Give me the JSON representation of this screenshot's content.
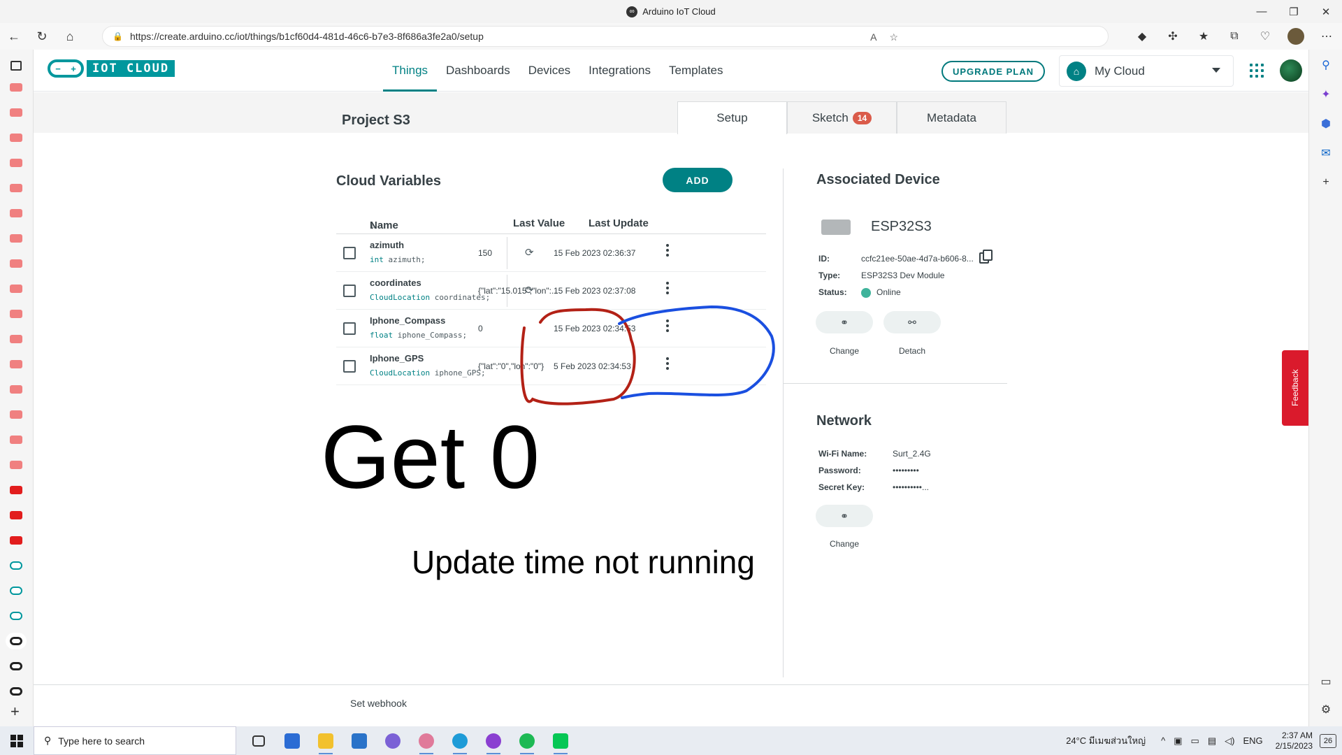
{
  "window": {
    "title": "Arduino IoT Cloud"
  },
  "browser": {
    "url": "https://create.arduino.cc/iot/things/b1cf60d4-481d-46c6-b7e3-8f686a3fe2a0/setup"
  },
  "app": {
    "nav": [
      {
        "label": "Things",
        "active": true
      },
      {
        "label": "Dashboards"
      },
      {
        "label": "Devices"
      },
      {
        "label": "Integrations"
      },
      {
        "label": "Templates"
      }
    ],
    "upgrade_label": "UPGRADE PLAN",
    "cloud_name": "My Cloud"
  },
  "thing": {
    "title": "Project S3",
    "tabs": [
      {
        "label": "Setup",
        "active": true
      },
      {
        "label": "Sketch",
        "badge": "14"
      },
      {
        "label": "Metadata"
      }
    ]
  },
  "variables": {
    "title": "Cloud Variables",
    "add_label": "ADD",
    "columns": {
      "name": "Name",
      "last_value": "Last Value",
      "last_update": "Last Update"
    },
    "rows": [
      {
        "name": "azimuth",
        "type": "int",
        "decl": " azimuth;",
        "value": "150",
        "updated": "15 Feb 2023 02:36:37",
        "sync": true
      },
      {
        "name": "coordinates",
        "type": "CloudLocation",
        "decl": " coordinates;",
        "value": "{\"lat\":\"15.015\",\"lon\":...",
        "updated": "15 Feb 2023 02:37:08",
        "sync": true
      },
      {
        "name": "Iphone_Compass",
        "type": "float",
        "decl": " iphone_Compass;",
        "value": "0",
        "updated": "15 Feb 2023 02:34:53",
        "sync": false
      },
      {
        "name": "Iphone_GPS",
        "type": "CloudLocation",
        "decl": " iphone_GPS;",
        "value": "{\"lat\":\"0\",\"lon\":\"0\"}",
        "updated": "5 Feb 2023 02:34:53",
        "sync": false
      }
    ]
  },
  "annotations": {
    "big": "Get 0",
    "sub": "Update time not running",
    "circle_colors": {
      "red": "#b32116",
      "blue": "#1a4fe0"
    }
  },
  "device": {
    "title": "Associated Device",
    "name": "ESP32S3",
    "id_label": "ID:",
    "id_value": "ccfc21ee-50ae-4d7a-b606-8...",
    "type_label": "Type:",
    "type_value": "ESP32S3 Dev Module",
    "status_label": "Status:",
    "status_value": "Online",
    "change_label": "Change",
    "detach_label": "Detach"
  },
  "network": {
    "title": "Network",
    "wifi_label": "Wi-Fi Name:",
    "wifi_value": "Surt_2.4G",
    "password_label": "Password:",
    "password_value": "•••••••••",
    "secret_label": "Secret Key:",
    "secret_value": "••••••••••...",
    "change_label": "Change"
  },
  "footer": {
    "webhook": "Set webhook"
  },
  "feedback": "Feedback",
  "taskbar": {
    "search_placeholder": "Type here to search",
    "weather": "24°C มีเมฆส่วนใหญ่",
    "lang": "ENG",
    "time": "2:37 AM",
    "date": "2/15/2023",
    "notifications": "26"
  },
  "colors": {
    "accent": "#008184",
    "badge": "#da5b4a",
    "online": "#3fb39b",
    "feedback": "#da1a2c"
  }
}
